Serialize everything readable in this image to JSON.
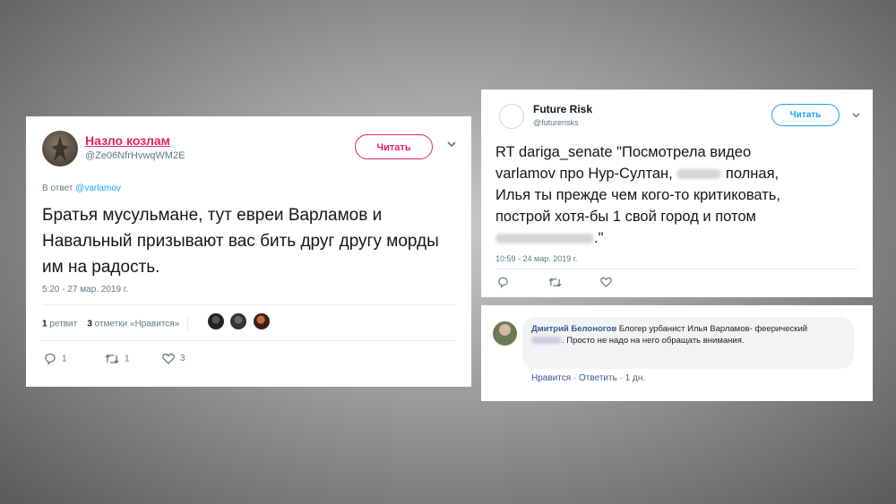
{
  "tweet1": {
    "name": "Назло козлам",
    "handle": "@Ze06NfrHvwqWM2E",
    "follow_label": "Читать",
    "reply_prefix": "В ответ",
    "reply_mention": "@varlamov",
    "text": "Братья мусульмане, тут евреи Варламов и Навальный призывают вас бить друг другу морды им на радость.",
    "timestamp": "5:20 - 27 мар. 2019 г.",
    "retweets_count": "1",
    "retweets_label": "ретвит",
    "likes_count": "3",
    "likes_label": "отметки «Нравится»",
    "replies": "1",
    "retweets": "1",
    "likes": "3",
    "colors": {
      "accent": "#e0245e"
    }
  },
  "tweet2": {
    "name": "Future Risk",
    "handle": "@futurerisks",
    "follow_label": "Читать",
    "text_line1": "RT dariga_senate \"Посмотрела видео",
    "text_line2_a": "varlamov про Нур-Султан,",
    "text_line2_b": "полная,",
    "text_line3": "Илья ты прежде чем кого-то критиковать,",
    "text_line4": "построй хотя-бы 1 свой город и потом",
    "text_line5_end": ".\"",
    "timestamp": "10:59 - 24 мар. 2019 г.",
    "colors": {
      "accent": "#1da1f2"
    }
  },
  "comment": {
    "author": "Дмитрий Белоногов",
    "text_a": "Блогер урбанист Илья Варламов- феерический",
    "text_b": ". Просто не надо на него обращать внимания.",
    "like_label": "Нравится",
    "reply_label": "Ответить",
    "time": "1 дн.",
    "colors": {
      "link": "#385898"
    }
  }
}
